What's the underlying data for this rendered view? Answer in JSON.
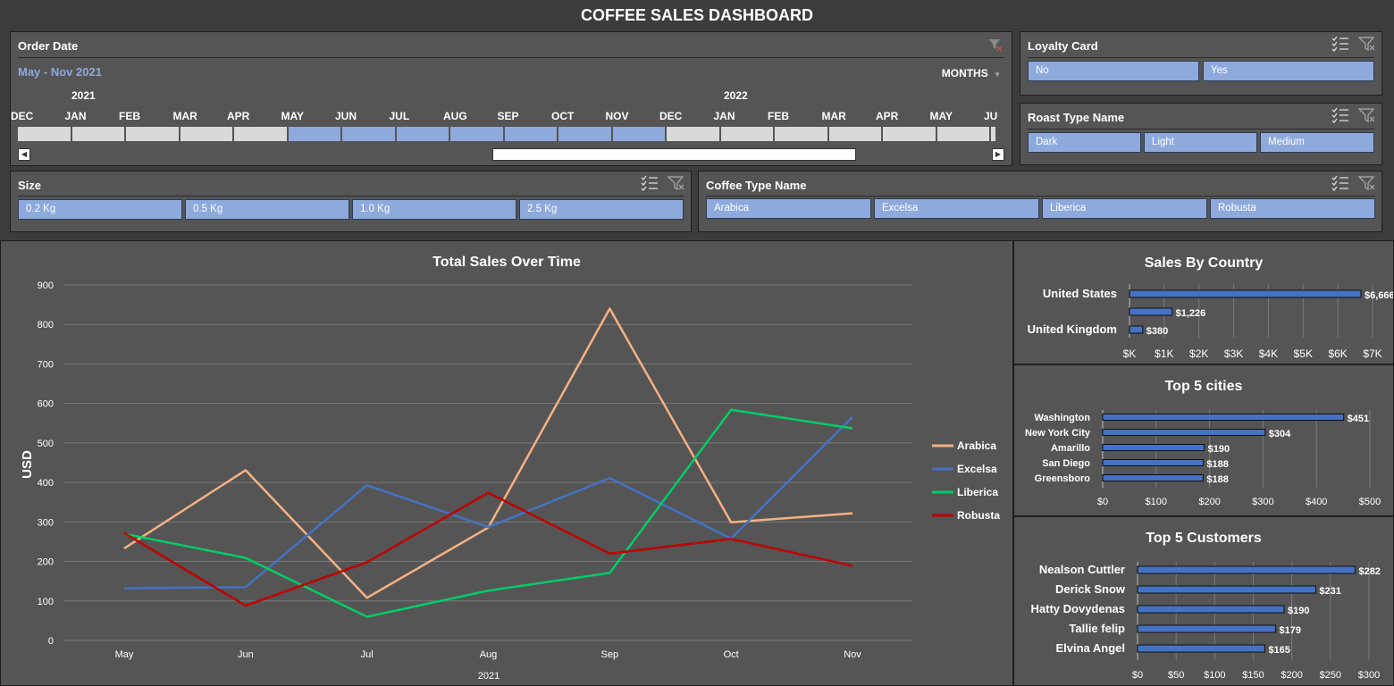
{
  "dashboard_title": "COFFEE SALES DASHBOARD",
  "order_date": {
    "title": "Order Date",
    "range_label": "May - Nov 2021",
    "period_label": "MONTHS",
    "years": [
      "2021",
      "2022"
    ],
    "months": [
      "DEC",
      "JAN",
      "FEB",
      "MAR",
      "APR",
      "MAY",
      "JUN",
      "JUL",
      "AUG",
      "SEP",
      "OCT",
      "NOV",
      "DEC",
      "JAN",
      "FEB",
      "MAR",
      "APR",
      "MAY",
      "JU"
    ],
    "selected_months": [
      "MAY",
      "JUN",
      "JUL",
      "AUG",
      "SEP",
      "OCT",
      "NOV"
    ]
  },
  "loyalty_card": {
    "title": "Loyalty Card",
    "options": [
      "No",
      "Yes"
    ]
  },
  "roast_type": {
    "title": "Roast Type Name",
    "options": [
      "Dark",
      "Light",
      "Medium"
    ]
  },
  "size": {
    "title": "Size",
    "options": [
      "0.2 Kg",
      "0.5 Kg",
      "1.0 Kg",
      "2.5 Kg"
    ]
  },
  "coffee_type": {
    "title": "Coffee Type Name",
    "options": [
      "Arabica",
      "Excelsa",
      "Liberica",
      "Robusta"
    ]
  },
  "colors": {
    "panel": "#555555",
    "background": "#3c3c3c",
    "slicer_button": "#8ea9db",
    "bar": "#4472c4",
    "arabica": "#f4b183",
    "excelsa": "#4472c4",
    "liberica": "#00cc66",
    "robusta": "#c00000"
  },
  "chart_data": [
    {
      "type": "line",
      "title": "Total Sales Over Time",
      "xlabel": "2021",
      "ylabel": "USD",
      "categories": [
        "May",
        "Jun",
        "Jul",
        "Aug",
        "Sep",
        "Oct",
        "Nov"
      ],
      "ylim": [
        0,
        900
      ],
      "yticks": [
        0,
        100,
        200,
        300,
        400,
        500,
        600,
        700,
        800,
        900
      ],
      "grid": true,
      "legend": "right",
      "series": [
        {
          "name": "Arabica",
          "color": "#f4b183",
          "values": [
            233,
            431,
            108,
            286,
            840,
            299,
            322
          ]
        },
        {
          "name": "Excelsa",
          "color": "#4472c4",
          "values": [
            132,
            135,
            393,
            287,
            411,
            258,
            566
          ]
        },
        {
          "name": "Liberica",
          "color": "#00cc66",
          "values": [
            270,
            209,
            60,
            126,
            171,
            584,
            537
          ]
        },
        {
          "name": "Robusta",
          "color": "#c00000",
          "values": [
            272,
            88,
            198,
            374,
            220,
            257,
            189
          ]
        }
      ]
    },
    {
      "type": "bar",
      "orientation": "horizontal",
      "title": "Sales By Country",
      "categories": [
        "United States",
        "",
        "United Kingdom"
      ],
      "values": [
        6666,
        1226,
        380
      ],
      "labels": [
        "$6,666",
        "$1,226",
        "$380"
      ],
      "xlim": [
        0,
        7000
      ],
      "xticks": [
        "$K",
        "$1K",
        "$2K",
        "$3K",
        "$4K",
        "$5K",
        "$6K",
        "$7K"
      ],
      "grid": true
    },
    {
      "type": "bar",
      "orientation": "horizontal",
      "title": "Top 5 cities",
      "categories": [
        "Washington",
        "New York City",
        "Amarillo",
        "San Diego",
        "Greensboro"
      ],
      "values": [
        451,
        304,
        190,
        188,
        188
      ],
      "labels": [
        "$451",
        "$304",
        "$190",
        "$188",
        "$188"
      ],
      "xlim": [
        0,
        500
      ],
      "xticks": [
        "$0",
        "$100",
        "$200",
        "$300",
        "$400",
        "$500"
      ],
      "grid": true
    },
    {
      "type": "bar",
      "orientation": "horizontal",
      "title": "Top 5 Customers",
      "categories": [
        "Nealson Cuttler",
        "Derick Snow",
        "Hatty Dovydenas",
        "Tallie felip",
        "Elvina Angel"
      ],
      "values": [
        282,
        231,
        190,
        179,
        165
      ],
      "labels": [
        "$282",
        "$231",
        "$190",
        "$179",
        "$165"
      ],
      "xlim": [
        0,
        300
      ],
      "xticks": [
        "$0",
        "$50",
        "$100",
        "$150",
        "$200",
        "$250",
        "$300"
      ],
      "grid": true
    }
  ]
}
